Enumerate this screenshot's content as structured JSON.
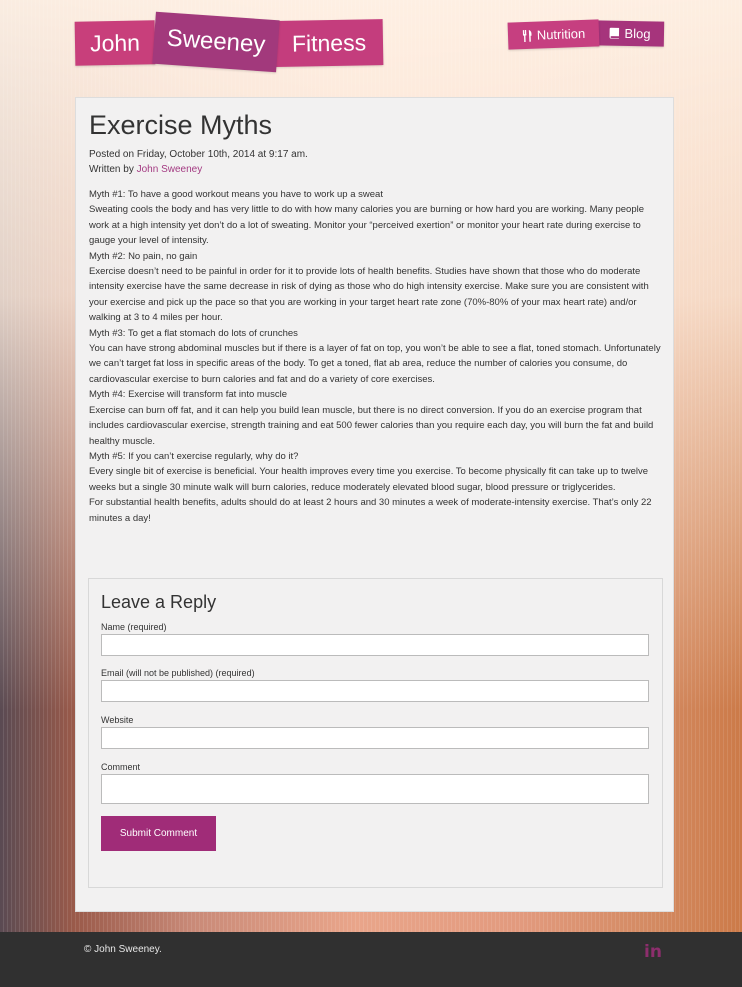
{
  "header": {
    "logo": {
      "word1": "John",
      "word2": "Sweeney",
      "word3": "Fitness"
    },
    "nav": {
      "nutrition_label": "Nutrition",
      "nutrition_icon": "fork-knife-icon",
      "blog_label": "Blog",
      "blog_icon": "book-icon"
    }
  },
  "post": {
    "title": "Exercise Myths",
    "posted_on": "Posted on Friday, October 10th, 2014 at 9:17 am.",
    "written_by_prefix": "Written by ",
    "author": "John Sweeney",
    "paragraphs": [
      "Myth #1: To have a good workout means you have to work up a sweat",
      "Sweating cools the body and has very little to do with how many calories you are burning or how hard you are working. Many people work at a high intensity yet don’t do a lot of sweating.  Monitor your “perceived exertion” or monitor your heart rate during exercise to gauge your level of intensity.",
      "Myth #2: No pain, no gain",
      "Exercise doesn’t need to be painful in order for it to provide lots of health benefits. Studies have shown that those who do moderate intensity exercise have the same decrease in risk of dying as those who do high intensity exercise. Make sure you are consistent with your exercise and pick up the pace so that you are working in your target heart rate zone (70%-80% of your max heart rate) and/or walking at 3 to 4 miles per hour.",
      "Myth #3: To get a flat stomach do lots of crunches",
      "You can have strong abdominal muscles but if there is a layer of fat on top, you won’t be able to see a flat, toned stomach. Unfortunately we can’t target fat loss in specific areas of the body. To get a toned, flat ab area, reduce the number of calories you consume, do cardiovascular exercise to burn calories and fat and do a variety of core exercises.",
      "Myth #4: Exercise will transform fat into muscle",
      "Exercise can burn off fat, and it can help you build lean muscle, but there is no direct conversion. If you do an exercise program that includes cardiovascular exercise, strength training and eat 500 fewer calories than you require each day, you will burn the fat and build healthy muscle.",
      "Myth #5: If you can’t exercise regularly, why do it?",
      "Every single bit of exercise is beneficial. Your health improves every time you exercise. To become physically fit can take up to twelve weeks but a single 30 minute walk will burn calories, reduce moderately elevated blood sugar, blood pressure or triglycerides.",
      "For substantial health benefits, adults should do at least 2 hours and 30 minutes a week of moderate-intensity exercise. That’s only 22 minutes a day!"
    ]
  },
  "reply_form": {
    "title": "Leave a Reply",
    "name_label": "Name (required)",
    "email_label": "Email (will not be published) (required)",
    "website_label": "Website",
    "comment_label": "Comment",
    "submit_label": "Submit Comment"
  },
  "footer": {
    "copyright": "© John Sweeney.",
    "social_icon": "linkedin-icon",
    "linkedin_glyph": "in"
  },
  "colors": {
    "brand_pink": "#c83f7b",
    "brand_purple": "#a2397c",
    "button": "#a02c78",
    "footer_bg": "#303030"
  }
}
